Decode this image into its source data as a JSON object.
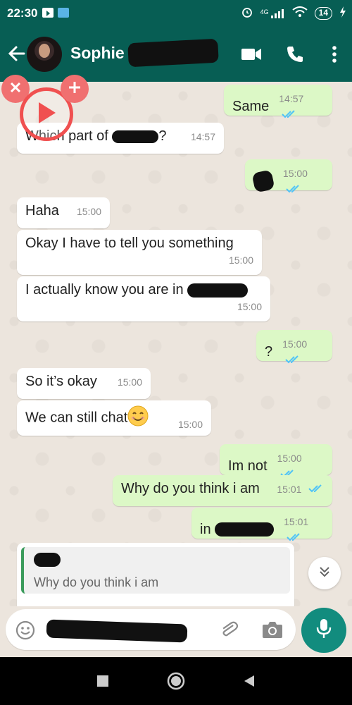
{
  "status_bar": {
    "time": "22:30",
    "network": "4G",
    "battery": "14",
    "icons": [
      "youtube-icon",
      "app-icon",
      "alarm-icon",
      "signal-icon",
      "wifi-icon",
      "battery-icon",
      "charging-icon"
    ]
  },
  "header": {
    "contact_name": "Sophie",
    "icons": [
      "back-arrow-icon",
      "video-call-icon",
      "voice-call-icon",
      "more-options-icon"
    ]
  },
  "messages": [
    {
      "dir": "out",
      "text": "Same",
      "time": "14:57",
      "read": true
    },
    {
      "dir": "in",
      "text": "Which part of ",
      "text_after": "?",
      "time": "14:57"
    },
    {
      "dir": "out",
      "text": "",
      "time": "15:00",
      "read": true
    },
    {
      "dir": "in",
      "text": "Haha",
      "time": "15:00"
    },
    {
      "dir": "in",
      "text": "Okay I have to tell you something",
      "time": "15:00"
    },
    {
      "dir": "in",
      "text": "I actually know you are in ",
      "time": "15:00"
    },
    {
      "dir": "out",
      "text": "?",
      "time": "15:00",
      "read": true
    },
    {
      "dir": "in",
      "text": "So it’s okay",
      "time": "15:00"
    },
    {
      "dir": "in",
      "text": "We can still chat",
      "emoji": "😊",
      "time": "15:00"
    },
    {
      "dir": "out",
      "text": "Im not",
      "time": "15:00",
      "read": true
    },
    {
      "dir": "out",
      "text": "Why do you think i am",
      "time": "15:01",
      "read": true
    },
    {
      "dir": "out",
      "text": "in ",
      "time": "15:01",
      "read": true
    }
  ],
  "reply": {
    "quoted_text": "Why do you think i am"
  },
  "input": {
    "icons": [
      "emoji-icon",
      "attach-icon",
      "camera-icon",
      "mic-icon"
    ]
  },
  "colors": {
    "header": "#075e54",
    "chat_bg": "#ece5dd",
    "outgoing": "#dcf8c6",
    "incoming": "#ffffff",
    "read_ticks": "#4fc3f7",
    "mic": "#128c7e",
    "overlay": "#f05050"
  }
}
